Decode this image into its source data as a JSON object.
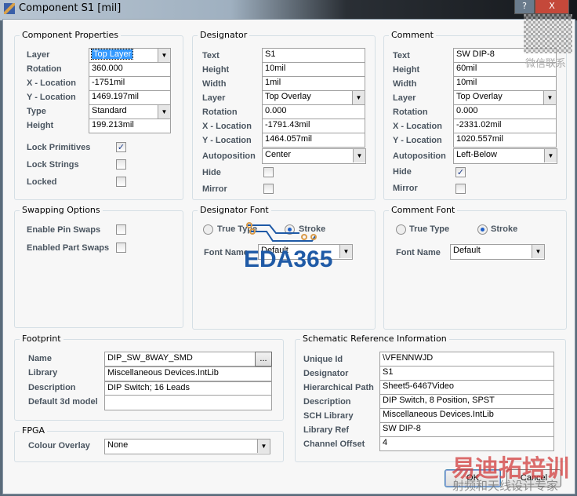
{
  "window": {
    "title": "Component S1 [mil]",
    "help": "?",
    "close": "X"
  },
  "component_properties": {
    "title": "Component Properties",
    "layer_label": "Layer",
    "layer": "Top Layer",
    "rotation_label": "Rotation",
    "rotation": "360.000",
    "x_label": "X - Location",
    "x": "-1751mil",
    "y_label": "Y - Location",
    "y": "1469.197mil",
    "type_label": "Type",
    "type": "Standard",
    "height_label": "Height",
    "height": "199.213mil",
    "lock_primitives_label": "Lock Primitives",
    "lock_primitives": true,
    "lock_strings_label": "Lock Strings",
    "lock_strings": false,
    "locked_label": "Locked",
    "locked": false
  },
  "designator": {
    "title": "Designator",
    "text_label": "Text",
    "text": "S1",
    "height_label": "Height",
    "height": "10mil",
    "width_label": "Width",
    "width": "1mil",
    "layer_label": "Layer",
    "layer": "Top Overlay",
    "rotation_label": "Rotation",
    "rotation": "0.000",
    "x_label": "X - Location",
    "x": "-1791.43mil",
    "y_label": "Y - Location",
    "y": "1464.057mil",
    "autopos_label": "Autoposition",
    "autopos": "Center",
    "hide_label": "Hide",
    "hide": false,
    "mirror_label": "Mirror",
    "mirror": false
  },
  "comment": {
    "title": "Comment",
    "text_label": "Text",
    "text": "SW DIP-8",
    "height_label": "Height",
    "height": "60mil",
    "width_label": "Width",
    "width": "10mil",
    "layer_label": "Layer",
    "layer": "Top Overlay",
    "rotation_label": "Rotation",
    "rotation": "0.000",
    "x_label": "X - Location",
    "x": "-2331.02mil",
    "y_label": "Y - Location",
    "y": "1020.557mil",
    "autopos_label": "Autoposition",
    "autopos": "Left-Below",
    "hide_label": "Hide",
    "hide": true,
    "mirror_label": "Mirror",
    "mirror": false
  },
  "swapping": {
    "title": "Swapping Options",
    "pin_label": "Enable Pin Swaps",
    "part_label": "Enabled Part Swaps"
  },
  "designator_font": {
    "title": "Designator Font",
    "truetype": "True Type",
    "stroke": "Stroke",
    "font_name_label": "Font Name",
    "font_name": "Default"
  },
  "comment_font": {
    "title": "Comment Font",
    "truetype": "True Type",
    "stroke": "Stroke",
    "font_name_label": "Font Name",
    "font_name": "Default"
  },
  "footprint": {
    "title": "Footprint",
    "name_label": "Name",
    "name": "DIP_SW_8WAY_SMD",
    "browse": "...",
    "library_label": "Library",
    "library": "Miscellaneous Devices.IntLib",
    "description_label": "Description",
    "description": "DIP Switch; 16 Leads",
    "model_label": "Default 3d model",
    "model": ""
  },
  "fpga": {
    "title": "FPGA",
    "overlay_label": "Colour Overlay",
    "overlay": "None"
  },
  "schematic": {
    "title": "Schematic Reference Information",
    "uid_label": "Unique Id",
    "uid": "\\VFENNWJD",
    "des_label": "Designator",
    "des": "S1",
    "path_label": "Hierarchical Path",
    "path": "Sheet5-6467Video",
    "desc_label": "Description",
    "desc": "DIP Switch, 8 Position, SPST",
    "lib_label": "SCH Library",
    "lib": "Miscellaneous Devices.IntLib",
    "ref_label": "Library Ref",
    "ref": "SW DIP-8",
    "offset_label": "Channel Offset",
    "offset": "4"
  },
  "buttons": {
    "ok": "OK",
    "cancel": "Cancel"
  },
  "watermarks": {
    "logo": "EDA365",
    "cn1": "易迪拓培训",
    "cn2": "射频和天线设计专家",
    "qr": "微信联系"
  }
}
